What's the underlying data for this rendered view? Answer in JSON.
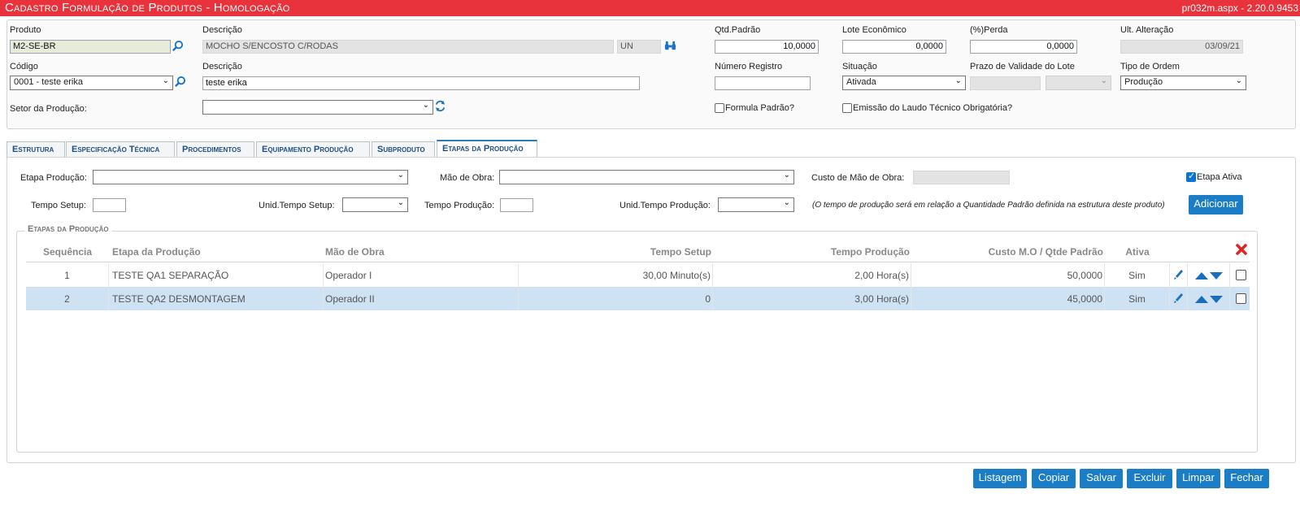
{
  "header": {
    "title": "Cadastro Formulação de Produtos  - Homologação",
    "version": "pr032m.aspx - 2.20.0.9453"
  },
  "form": {
    "produto_label": "Produto",
    "produto_value": "M2-SE-BR",
    "descricao1_label": "Descrição",
    "descricao1_value": "MOCHO S/ENCOSTO C/RODAS",
    "unidade_value": "UN",
    "qtd_padrao_label": "Qtd.Padrão",
    "qtd_padrao_value": "10,0000",
    "lote_label": "Lote Econômico",
    "lote_value": "0,0000",
    "perda_label": "(%)Perda",
    "perda_value": "0,0000",
    "ult_alteracao_label": "Ult. Alteração",
    "ult_alteracao_value": "03/09/21",
    "codigo_label": "Código",
    "codigo_value": "0001 - teste erika",
    "descricao2_label": "Descrição",
    "descricao2_value": "teste erika",
    "num_registro_label": "Número Registro",
    "num_registro_value": "",
    "situacao_label": "Situação",
    "situacao_value": "Ativada",
    "prazo_label": "Prazo de Validade do Lote",
    "tipo_ordem_label": "Tipo de Ordem",
    "tipo_ordem_value": "Produção",
    "setor_label": "Setor da Produção:",
    "setor_value": "",
    "formula_padrao_label": "Formula Padrão?",
    "emissao_laudo_label": "Emissão do Laudo Técnico Obrigatória?"
  },
  "tabs": [
    {
      "label": "Estrutura"
    },
    {
      "label": "Especificação Técnica"
    },
    {
      "label": "Procedimentos"
    },
    {
      "label": "Equipamento Produção"
    },
    {
      "label": "Subproduto"
    },
    {
      "label": "Etapas da Produção"
    }
  ],
  "etapas": {
    "etapa_label": "Etapa Produção:",
    "mao_obra_label": "Mão de Obra:",
    "custo_label": "Custo de Mão de Obra:",
    "etapa_ativa_label": "Etapa Ativa",
    "tempo_setup_label": "Tempo Setup:",
    "unid_setup_label": "Unid.Tempo Setup:",
    "tempo_producao_label": "Tempo Produção:",
    "unid_producao_label": "Unid.Tempo Produção:",
    "note": "(O tempo de produção será em relação a Quantidade Padrão definida na estrutura deste produto)",
    "adicionar_label": "Adicionar",
    "legend": "Etapas da Produção"
  },
  "grid": {
    "columns": [
      "Sequência",
      "Etapa da Produção",
      "Mão de Obra",
      "Tempo Setup",
      "Tempo Produção",
      "Custo M.O / Qtde Padrão",
      "Ativa"
    ],
    "rows": [
      {
        "seq": "1",
        "etapa": "TESTE QA1 SEPARAÇÃO",
        "mao": "Operador I",
        "setup": "30,00 Minuto(s)",
        "producao": "2,00 Hora(s)",
        "custo": "50,0000",
        "ativa": "Sim"
      },
      {
        "seq": "2",
        "etapa": "TESTE QA2 DESMONTAGEM",
        "mao": "Operador II",
        "setup": "0",
        "producao": "3,00 Hora(s)",
        "custo": "45,0000",
        "ativa": "Sim"
      }
    ]
  },
  "footer": {
    "listagem": "Listagem",
    "copiar": "Copiar",
    "salvar": "Salvar",
    "excluir": "Excluir",
    "limpar": "Limpar",
    "fechar": "Fechar"
  }
}
